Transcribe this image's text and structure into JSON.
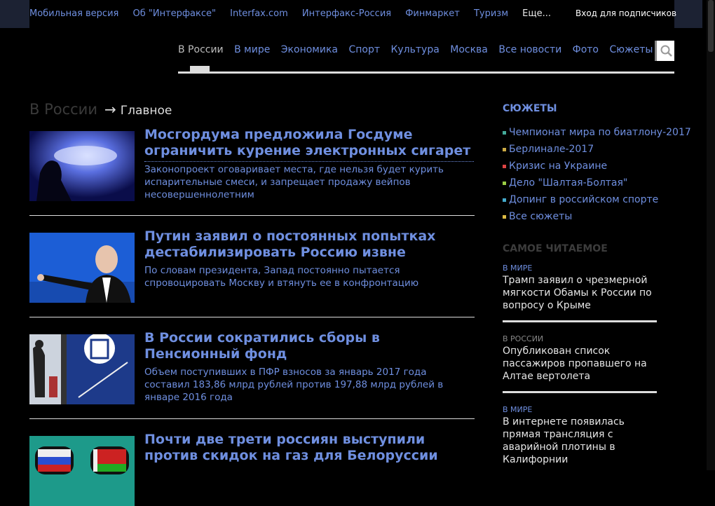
{
  "top": {
    "links": [
      "Мобильная версия",
      "Об \"Интерфаксе\"",
      "Interfax.com",
      "Интерфакс-Россия",
      "Финмаркет",
      "Туризм"
    ],
    "more": "Еще...",
    "login": "Вход для подписчиков"
  },
  "nav": {
    "items": [
      "В России",
      "В мире",
      "Экономика",
      "Спорт",
      "Культура",
      "Москва",
      "Все новости",
      "Фото",
      "Сюжеты"
    ]
  },
  "breadcrumb": {
    "section": "В России",
    "arrow": "→",
    "page": "Главное"
  },
  "news": [
    {
      "title": "Мосгордума предложила Госдуме ограничить курение электронных сигарет",
      "lead": "Законопроект оговаривает места, где нельзя будет курить испарительные смеси, и запрещает продажу вейпов несовершеннолетним"
    },
    {
      "title": "Путин заявил о постоянных попытках дестабилизировать Россию извне",
      "lead": "По словам президента, Запад постоянно пытается спровоцировать Москву и втянуть ее в конфронтацию"
    },
    {
      "title": "В России сократились сборы в Пенсионный фонд",
      "lead": "Объем поступивших в ПФР взносов за январь 2017 года составил 183,86 млрд рублей против 197,88 млрд рублей в январе 2016 года"
    },
    {
      "title": "Почти две трети россиян выступили против скидок на газ для Белоруссии",
      "lead": ""
    }
  ],
  "stories": {
    "heading": "СЮЖЕТЫ",
    "items": [
      "Чемпионат мира по биатлону-2017",
      "Берлинале-2017",
      "Кризис на Украине",
      "Дело \"Шалтая-Болтая\"",
      "Допинг в российском спорте",
      "Все сюжеты"
    ],
    "bullet_colors": [
      "#4a9",
      "#ca4",
      "#d44",
      "#9c4",
      "#4ac",
      "#db4"
    ]
  },
  "popular": {
    "heading": "САМОЕ ЧИТАЕМОЕ",
    "items": [
      {
        "rubric": "В МИРЕ",
        "title": "Трамп заявил о чрезмерной мягкости Обамы к России по вопросу о Крыме"
      },
      {
        "rubric": "В РОССИИ",
        "title": "Опубликован список пассажиров пропавшего на Алтае вертолета"
      },
      {
        "rubric": "В МИРЕ",
        "title": "В интернете появилась прямая трансляция с аварийной плотины в Калифорнии"
      }
    ]
  },
  "colors": {
    "link": "#6f8fe0",
    "background": "#000000",
    "text": "#e6e6e6"
  }
}
